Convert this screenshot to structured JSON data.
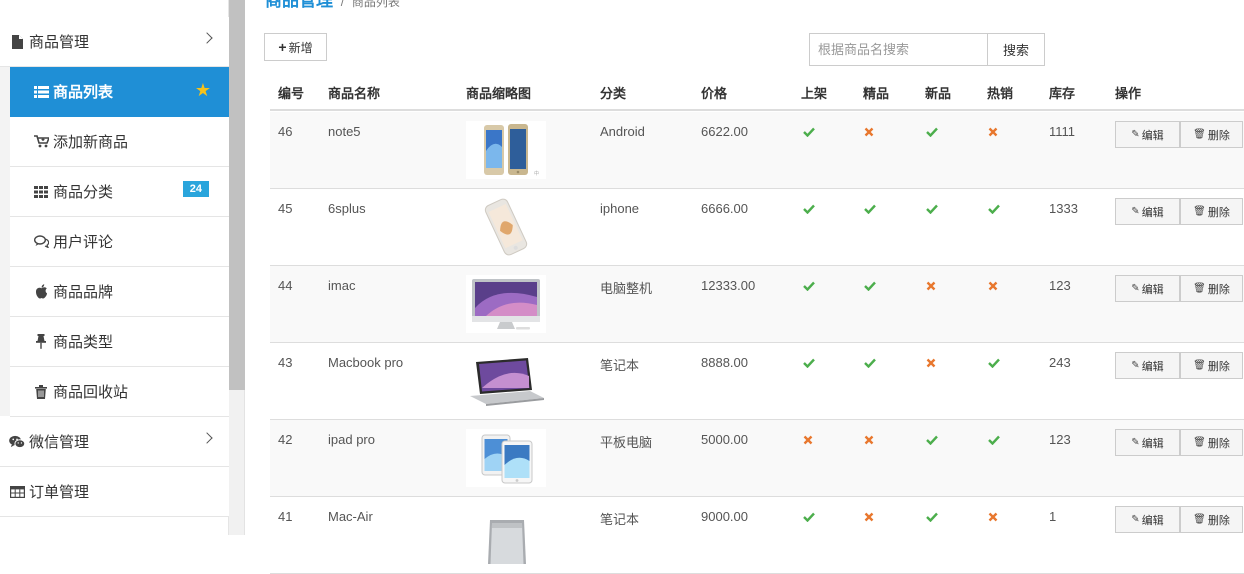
{
  "sidebar": {
    "groups": [
      {
        "label": "商品管理",
        "icon": "file-icon"
      },
      {
        "label": "微信管理",
        "icon": "wechat-icon"
      },
      {
        "label": "订单管理",
        "icon": "table-icon"
      }
    ],
    "items": [
      {
        "label": "商品列表",
        "icon": "list-icon",
        "active": true
      },
      {
        "label": "添加新商品",
        "icon": "cart-plus-icon"
      },
      {
        "label": "商品分类",
        "icon": "grid-icon",
        "badge": "24"
      },
      {
        "label": "用户评论",
        "icon": "comments-icon"
      },
      {
        "label": "商品品牌",
        "icon": "apple-icon"
      },
      {
        "label": "商品类型",
        "icon": "pin-icon"
      },
      {
        "label": "商品回收站",
        "icon": "trash-icon"
      }
    ]
  },
  "breadcrumb": {
    "main": "商品管理",
    "separator": "/",
    "sub": "商品列表"
  },
  "toolbar": {
    "add_label": "新增",
    "search_placeholder": "根据商品名搜索",
    "search_label": "搜索"
  },
  "table": {
    "headers": [
      "编号",
      "商品名称",
      "商品缩略图",
      "分类",
      "价格",
      "上架",
      "精品",
      "新品",
      "热销",
      "库存",
      "操作"
    ],
    "edit_label": "编辑",
    "delete_label": "删除",
    "rows": [
      {
        "id": "46",
        "name": "note5",
        "category": "Android",
        "price": "6622.00",
        "on_sale": true,
        "best": false,
        "new": true,
        "hot": false,
        "stock": "1111",
        "thumb": "phone"
      },
      {
        "id": "45",
        "name": "6splus",
        "category": "iphone",
        "price": "6666.00",
        "on_sale": true,
        "best": true,
        "new": true,
        "hot": true,
        "stock": "1333",
        "thumb": "iphone"
      },
      {
        "id": "44",
        "name": "imac",
        "category": "电脑整机",
        "price": "12333.00",
        "on_sale": true,
        "best": true,
        "new": false,
        "hot": false,
        "stock": "123",
        "thumb": "imac"
      },
      {
        "id": "43",
        "name": "Macbook pro",
        "category": "笔记本",
        "price": "8888.00",
        "on_sale": true,
        "best": true,
        "new": false,
        "hot": true,
        "stock": "243",
        "thumb": "laptop"
      },
      {
        "id": "42",
        "name": "ipad pro",
        "category": "平板电脑",
        "price": "5000.00",
        "on_sale": false,
        "best": false,
        "new": true,
        "hot": true,
        "stock": "123",
        "thumb": "ipad"
      },
      {
        "id": "41",
        "name": "Mac-Air",
        "category": "笔记本",
        "price": "9000.00",
        "on_sale": true,
        "best": false,
        "new": true,
        "hot": false,
        "stock": "1",
        "thumb": "air"
      }
    ]
  },
  "colors": {
    "accent": "#1f8fd6",
    "ok": "#4cae4c",
    "no": "#e8772e",
    "badge": "#2aa5dc",
    "star": "#f6c21a"
  }
}
